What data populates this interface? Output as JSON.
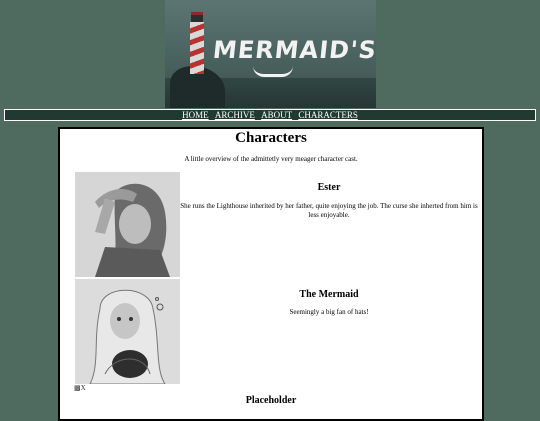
{
  "banner": {
    "title": "MERMAID'S TAIL"
  },
  "nav": {
    "items": [
      "HOME",
      "ARCHIVE",
      "ABOUT",
      "CHARACTERS"
    ]
  },
  "main": {
    "heading": "Characters",
    "intro": "A little overview of the admittetly very meager character cast.",
    "characters": [
      {
        "name": "Ester",
        "description": "She runs the Lighthouse inherited by her father, quite enjoying the job. The curse she inherted from him is less enjoyable."
      },
      {
        "name": "The Mermaid",
        "description": "Seemingly a big fan of hats!"
      },
      {
        "name": "Placeholder",
        "image_alt": "X"
      }
    ]
  },
  "colors": {
    "page_background": "#4f6b60",
    "nav_background": "#203a31",
    "panel_background": "#ffffff"
  }
}
